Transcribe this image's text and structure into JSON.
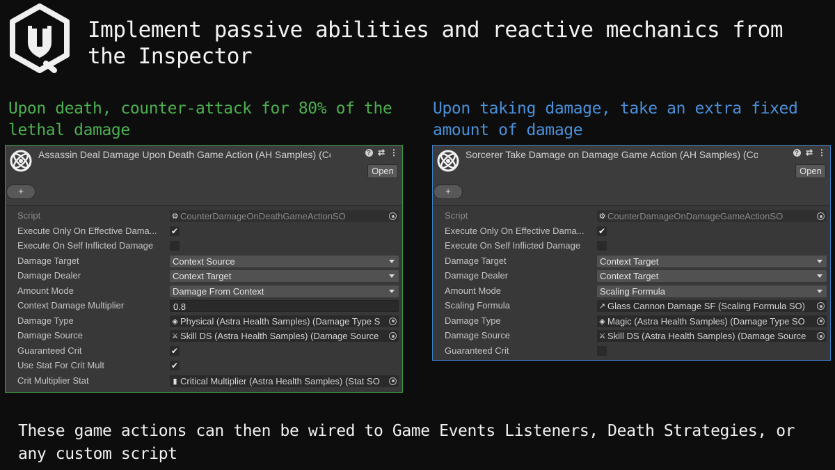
{
  "title": "Implement passive abilities and reactive mechanics from the Inspector",
  "footer": "These game actions can then be wired to Game Events Listeners, Death Strategies, or any custom script",
  "left": {
    "caption": "Upon death, counter-attack for 80% of the lethal damage",
    "header_title": "Assassin Deal Damage Upon Death Game Action (AH Samples) (Counter",
    "open_label": "Open",
    "add_label": "+",
    "rows": [
      {
        "label": "Script",
        "kind": "object",
        "icon": "script-icon",
        "icon_glyph": "⚙",
        "value": "CounterDamageOnDeathGameActionSO",
        "dim": true
      },
      {
        "label": "Execute Only On Effective Dama...",
        "kind": "checkbox",
        "checked": true,
        "glyph": "✔"
      },
      {
        "label": "Execute On Self Inflicted Damage",
        "kind": "checkbox",
        "checked": false,
        "glyph": ""
      },
      {
        "label": "Damage Target",
        "kind": "dropdown",
        "value": "Context Source"
      },
      {
        "label": "Damage Dealer",
        "kind": "dropdown",
        "value": "Context Target"
      },
      {
        "label": "Amount Mode",
        "kind": "dropdown",
        "value": "Damage From Context"
      },
      {
        "label": "Context Damage Multiplier",
        "kind": "text",
        "value": "0.8"
      },
      {
        "label": "Damage Type",
        "kind": "object",
        "icon": "damage-type-icon",
        "icon_glyph": "◈",
        "value": "Physical (Astra Health Samples) (Damage Type S"
      },
      {
        "label": "Damage Source",
        "kind": "object",
        "icon": "damage-source-icon",
        "icon_glyph": "⚔",
        "value": "Skill DS (Astra Health Samples) (Damage Source"
      },
      {
        "label": "Guaranteed Crit",
        "kind": "checkbox",
        "checked": true,
        "glyph": "✔"
      },
      {
        "label": "Use Stat For Crit Mult",
        "kind": "checkbox",
        "checked": true,
        "glyph": "✔"
      },
      {
        "label": "Crit Multiplier Stat",
        "kind": "object",
        "icon": "stat-icon",
        "icon_glyph": "▮",
        "value": "Critical Multiplier (Astra Health Samples) (Stat SO"
      }
    ]
  },
  "right": {
    "caption": "Upon taking damage, take an extra fixed amount of damage",
    "header_title": "Sorcerer Take Damage on Damage Game Action (AH Samples) (Counter",
    "open_label": "Open",
    "add_label": "+",
    "rows": [
      {
        "label": "Script",
        "kind": "object",
        "icon": "script-icon",
        "icon_glyph": "⚙",
        "value": "CounterDamageOnDamageGameActionSO",
        "dim": true
      },
      {
        "label": "Execute Only On Effective Dama...",
        "kind": "checkbox",
        "checked": true,
        "glyph": "✔"
      },
      {
        "label": "Execute On Self Inflicted Damage",
        "kind": "checkbox",
        "checked": false,
        "glyph": ""
      },
      {
        "label": "Damage Target",
        "kind": "dropdown",
        "value": "Context Target"
      },
      {
        "label": "Damage Dealer",
        "kind": "dropdown",
        "value": "Context Target"
      },
      {
        "label": "Amount Mode",
        "kind": "dropdown",
        "value": "Scaling Formula"
      },
      {
        "label": "Scaling Formula",
        "kind": "object",
        "icon": "scaling-formula-icon",
        "icon_glyph": "↗",
        "value": "Glass Cannon Damage SF (Scaling Formula SO)"
      },
      {
        "label": "Damage Type",
        "kind": "object",
        "icon": "damage-type-icon",
        "icon_glyph": "◈",
        "value": "Magic (Astra Health Samples) (Damage Type SO"
      },
      {
        "label": "Damage Source",
        "kind": "object",
        "icon": "damage-source-icon",
        "icon_glyph": "⚔",
        "value": "Skill DS (Astra Health Samples) (Damage Source"
      },
      {
        "label": "Guaranteed Crit",
        "kind": "checkbox",
        "checked": false,
        "glyph": ""
      }
    ]
  },
  "colors": {
    "left_accent": "#4caf50",
    "right_accent": "#4a90d9",
    "background": "#0d0d0d",
    "panel": "#383838"
  }
}
